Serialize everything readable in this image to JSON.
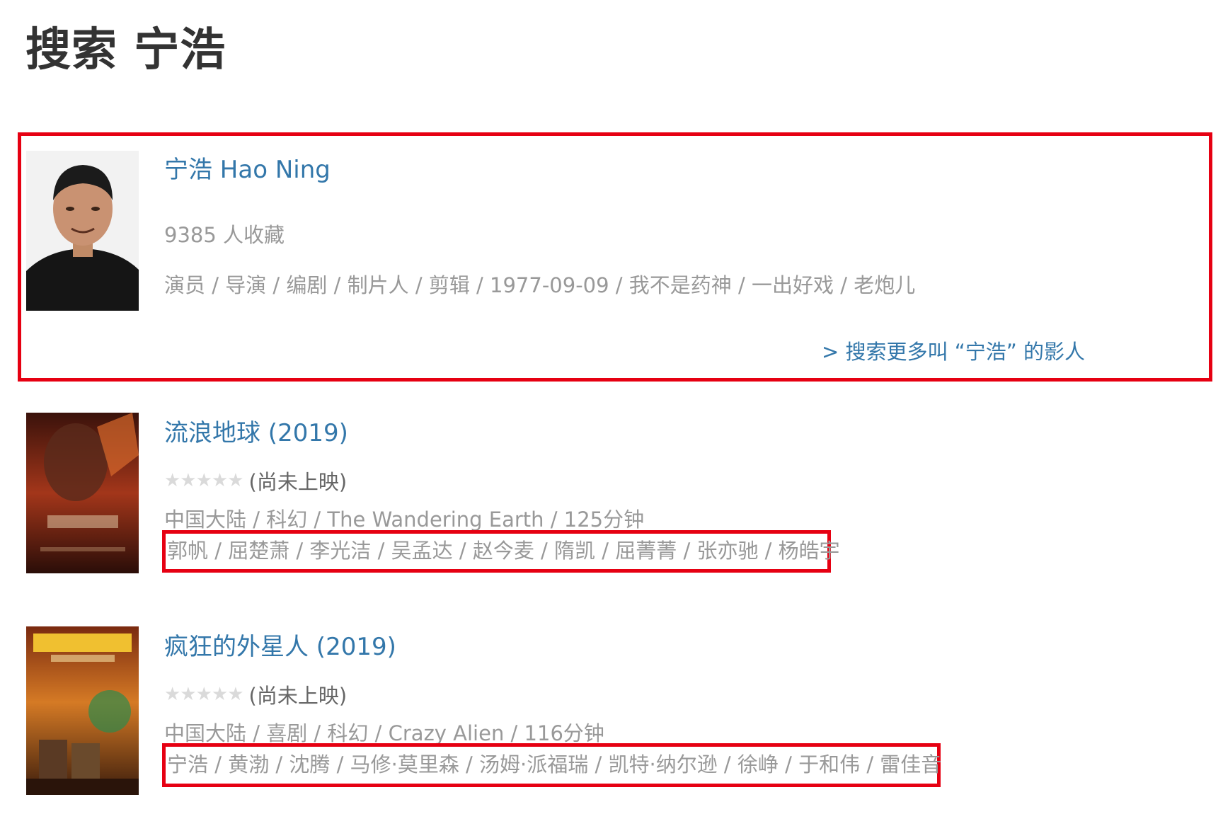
{
  "page": {
    "title": "搜索 宁浩"
  },
  "person": {
    "name": "宁浩 Hao Ning",
    "collect": "9385 人收藏",
    "info": "演员 / 导演 / 编剧 / 制片人 / 剪辑 / 1977-09-09 / 我不是药神 / 一出好戏 / 老炮儿",
    "more": "> 搜索更多叫 “宁浩” 的影人"
  },
  "movies": [
    {
      "title": "流浪地球 (2019)",
      "stars": "★★★★★",
      "rating_note": "(尚未上映)",
      "meta": "中国大陆 / 科幻 / The Wandering Earth / 125分钟",
      "cast": "郭帆 / 屈楚萧 / 李光洁 / 吴孟达 / 赵今麦 / 隋凯 / 屈菁菁 / 张亦驰 / 杨皓宇"
    },
    {
      "title": "疯狂的外星人 (2019)",
      "stars": "★★★★★",
      "rating_note": "(尚未上映)",
      "meta": "中国大陆 / 喜剧 / 科幻 / Crazy Alien / 116分钟",
      "cast": "宁浩 / 黄渤 / 沈腾 / 马修·莫里森 / 汤姆·派福瑞 / 凯特·纳尔逊 / 徐峥 / 于和伟 / 雷佳音"
    }
  ],
  "colors": {
    "link": "#3377aa",
    "highlight": "#e60012",
    "muted": "#999999"
  }
}
